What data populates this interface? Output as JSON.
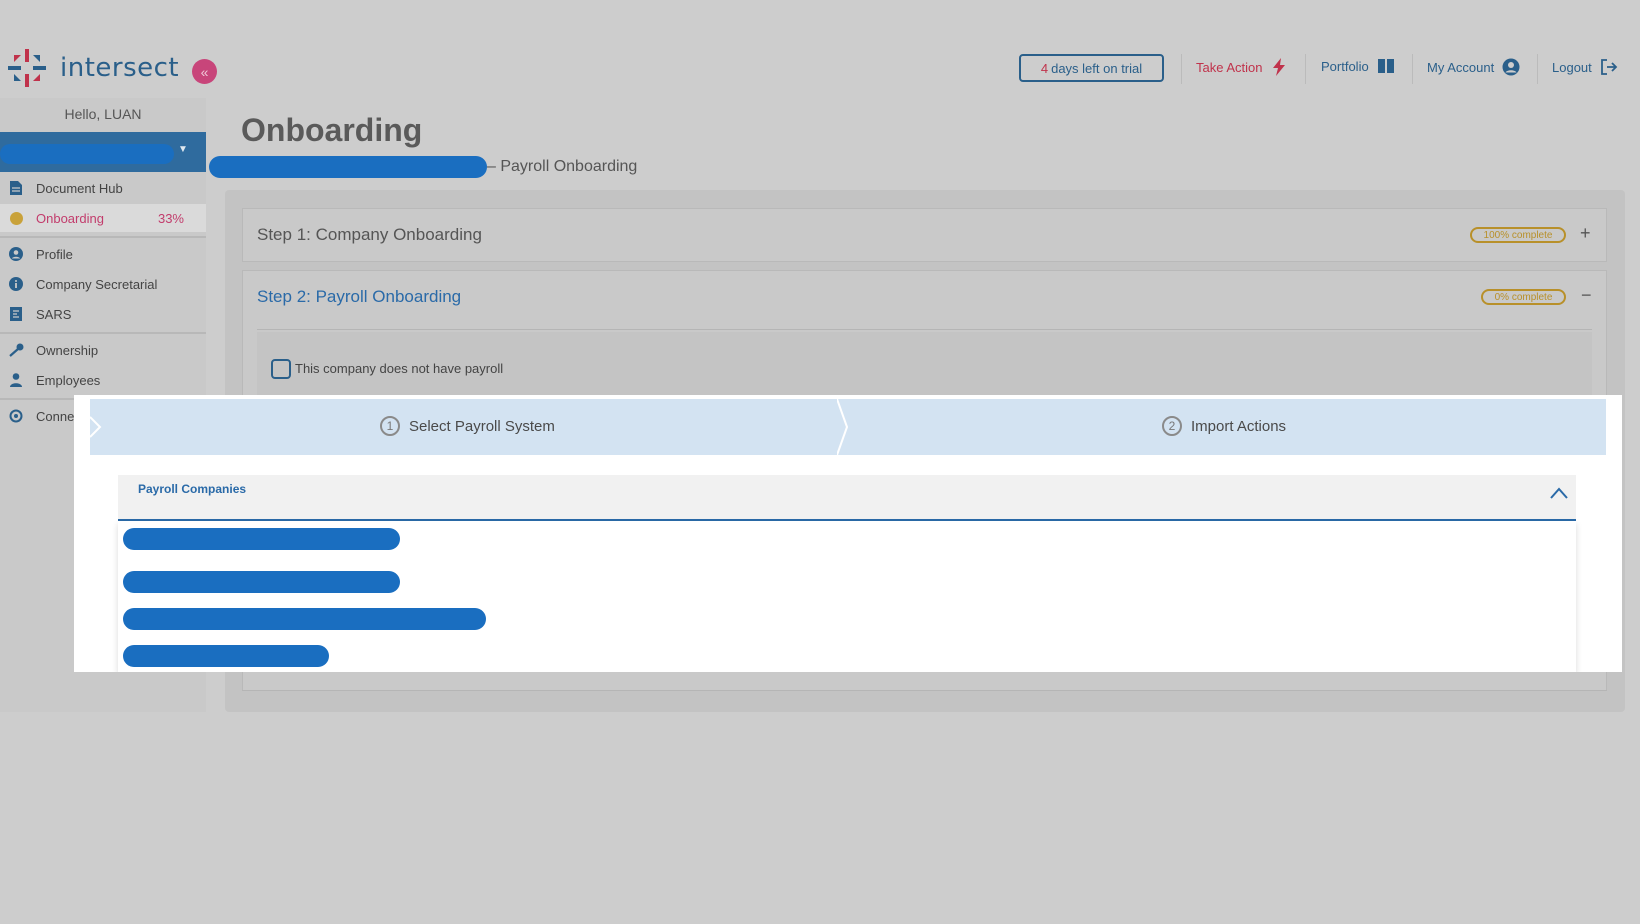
{
  "header": {
    "logo_text": "intersect",
    "collapse_icon": "«",
    "trial_days": "4",
    "trial_text": "days left on trial",
    "take_action": "Take Action",
    "portfolio": "Portfolio",
    "my_account": "My Account",
    "logout": "Logout"
  },
  "sidebar": {
    "greeting": "Hello, LUAN",
    "items": [
      {
        "label": "Document Hub",
        "icon": "document-icon"
      },
      {
        "label": "Onboarding",
        "icon": "progress-icon",
        "percent": "33%",
        "active": true
      },
      {
        "label": "Profile",
        "icon": "user-circle-icon"
      },
      {
        "label": "Company Secretarial",
        "icon": "info-icon"
      },
      {
        "label": "SARS",
        "icon": "tax-icon"
      },
      {
        "label": "Ownership",
        "icon": "key-icon"
      },
      {
        "label": "Employees",
        "icon": "person-icon"
      },
      {
        "label": "Connec",
        "icon": "connect-icon"
      }
    ]
  },
  "main": {
    "title": "Onboarding",
    "subtitle": "– Payroll Onboarding",
    "steps": [
      {
        "title": "Step 1: Company Onboarding",
        "badge": "100% complete",
        "toggle": "+"
      },
      {
        "title": "Step 2: Payroll Onboarding",
        "badge": "0% complete",
        "toggle": "−"
      }
    ],
    "no_payroll_label": "This company does not have payroll"
  },
  "wizard": {
    "steps": [
      {
        "num": "1",
        "label": "Select Payroll System"
      },
      {
        "num": "2",
        "label": "Import Actions"
      }
    ]
  },
  "dropdown": {
    "label": "Payroll Companies"
  },
  "colors": {
    "accent": "#2a6aa8",
    "brand_pink": "#c8457a",
    "redaction": "#1a6ec0",
    "badge": "#b8902a"
  }
}
